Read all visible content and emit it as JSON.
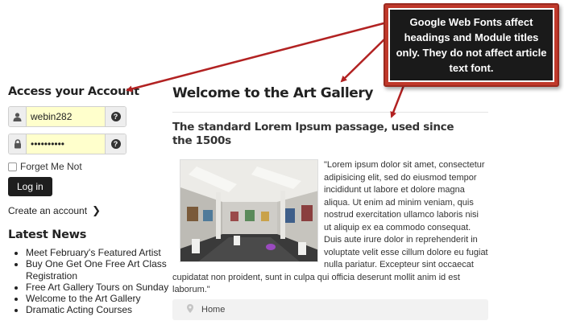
{
  "login": {
    "title": "Access your Account",
    "username_value": "webin282",
    "password_value": "••••••••••",
    "help_symbol": "?",
    "remember_label": "Forget Me Not",
    "login_button": "Log in",
    "create_account": "Create an account"
  },
  "news": {
    "title": "Latest News",
    "items": [
      "Meet February's Featured Artist",
      "Buy One Get One Free Art Class Registration",
      "Free Art Gallery Tours on Sunday",
      "Welcome to the Art Gallery",
      "Dramatic Acting Courses"
    ]
  },
  "article": {
    "title": "Welcome to the Art Gallery",
    "subtitle": "The standard Lorem Ipsum passage, used since the 1500s",
    "body": "\"Lorem ipsum dolor sit amet, consectetur adipisicing elit, sed do eiusmod tempor incididunt ut labore et dolore magna aliqua. Ut enim ad minim veniam, quis nostrud exercitation ullamco laboris nisi ut aliquip ex ea commodo consequat. Duis aute irure dolor in reprehenderit in voluptate velit esse cillum dolore eu fugiat nulla pariatur. Excepteur sint occaecat cupidatat non proident, sunt in culpa qui officia deserunt mollit anim id est laborum.\""
  },
  "breadcrumb": {
    "home": "Home"
  },
  "annotation": {
    "text": "Google Web Fonts affect headings and Module titles only. They do not affect article text font."
  },
  "colors": {
    "callout_fill": "#c0392b",
    "callout_inner": "#1a1a1a",
    "arrow": "#b22222",
    "input_bg": "#ffffcc"
  }
}
